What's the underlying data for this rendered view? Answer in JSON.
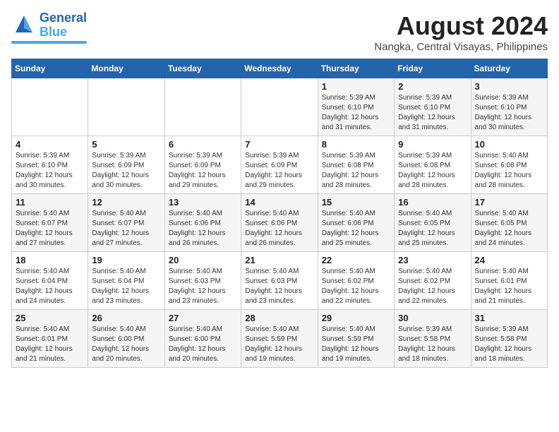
{
  "header": {
    "logo_line1": "General",
    "logo_line2": "Blue",
    "title": "August 2024",
    "subtitle": "Nangka, Central Visayas, Philippines"
  },
  "days_of_week": [
    "Sunday",
    "Monday",
    "Tuesday",
    "Wednesday",
    "Thursday",
    "Friday",
    "Saturday"
  ],
  "weeks": [
    [
      {
        "day": "",
        "info": ""
      },
      {
        "day": "",
        "info": ""
      },
      {
        "day": "",
        "info": ""
      },
      {
        "day": "",
        "info": ""
      },
      {
        "day": "1",
        "info": "Sunrise: 5:39 AM\nSunset: 6:10 PM\nDaylight: 12 hours\nand 31 minutes."
      },
      {
        "day": "2",
        "info": "Sunrise: 5:39 AM\nSunset: 6:10 PM\nDaylight: 12 hours\nand 31 minutes."
      },
      {
        "day": "3",
        "info": "Sunrise: 5:39 AM\nSunset: 6:10 PM\nDaylight: 12 hours\nand 30 minutes."
      }
    ],
    [
      {
        "day": "4",
        "info": "Sunrise: 5:39 AM\nSunset: 6:10 PM\nDaylight: 12 hours\nand 30 minutes."
      },
      {
        "day": "5",
        "info": "Sunrise: 5:39 AM\nSunset: 6:09 PM\nDaylight: 12 hours\nand 30 minutes."
      },
      {
        "day": "6",
        "info": "Sunrise: 5:39 AM\nSunset: 6:09 PM\nDaylight: 12 hours\nand 29 minutes."
      },
      {
        "day": "7",
        "info": "Sunrise: 5:39 AM\nSunset: 6:09 PM\nDaylight: 12 hours\nand 29 minutes."
      },
      {
        "day": "8",
        "info": "Sunrise: 5:39 AM\nSunset: 6:08 PM\nDaylight: 12 hours\nand 28 minutes."
      },
      {
        "day": "9",
        "info": "Sunrise: 5:39 AM\nSunset: 6:08 PM\nDaylight: 12 hours\nand 28 minutes."
      },
      {
        "day": "10",
        "info": "Sunrise: 5:40 AM\nSunset: 6:08 PM\nDaylight: 12 hours\nand 28 minutes."
      }
    ],
    [
      {
        "day": "11",
        "info": "Sunrise: 5:40 AM\nSunset: 6:07 PM\nDaylight: 12 hours\nand 27 minutes."
      },
      {
        "day": "12",
        "info": "Sunrise: 5:40 AM\nSunset: 6:07 PM\nDaylight: 12 hours\nand 27 minutes."
      },
      {
        "day": "13",
        "info": "Sunrise: 5:40 AM\nSunset: 6:06 PM\nDaylight: 12 hours\nand 26 minutes."
      },
      {
        "day": "14",
        "info": "Sunrise: 5:40 AM\nSunset: 6:06 PM\nDaylight: 12 hours\nand 26 minutes."
      },
      {
        "day": "15",
        "info": "Sunrise: 5:40 AM\nSunset: 6:06 PM\nDaylight: 12 hours\nand 25 minutes."
      },
      {
        "day": "16",
        "info": "Sunrise: 5:40 AM\nSunset: 6:05 PM\nDaylight: 12 hours\nand 25 minutes."
      },
      {
        "day": "17",
        "info": "Sunrise: 5:40 AM\nSunset: 6:05 PM\nDaylight: 12 hours\nand 24 minutes."
      }
    ],
    [
      {
        "day": "18",
        "info": "Sunrise: 5:40 AM\nSunset: 6:04 PM\nDaylight: 12 hours\nand 24 minutes."
      },
      {
        "day": "19",
        "info": "Sunrise: 5:40 AM\nSunset: 6:04 PM\nDaylight: 12 hours\nand 23 minutes."
      },
      {
        "day": "20",
        "info": "Sunrise: 5:40 AM\nSunset: 6:03 PM\nDaylight: 12 hours\nand 23 minutes."
      },
      {
        "day": "21",
        "info": "Sunrise: 5:40 AM\nSunset: 6:03 PM\nDaylight: 12 hours\nand 23 minutes."
      },
      {
        "day": "22",
        "info": "Sunrise: 5:40 AM\nSunset: 6:02 PM\nDaylight: 12 hours\nand 22 minutes."
      },
      {
        "day": "23",
        "info": "Sunrise: 5:40 AM\nSunset: 6:02 PM\nDaylight: 12 hours\nand 22 minutes."
      },
      {
        "day": "24",
        "info": "Sunrise: 5:40 AM\nSunset: 6:01 PM\nDaylight: 12 hours\nand 21 minutes."
      }
    ],
    [
      {
        "day": "25",
        "info": "Sunrise: 5:40 AM\nSunset: 6:01 PM\nDaylight: 12 hours\nand 21 minutes."
      },
      {
        "day": "26",
        "info": "Sunrise: 5:40 AM\nSunset: 6:00 PM\nDaylight: 12 hours\nand 20 minutes."
      },
      {
        "day": "27",
        "info": "Sunrise: 5:40 AM\nSunset: 6:00 PM\nDaylight: 12 hours\nand 20 minutes."
      },
      {
        "day": "28",
        "info": "Sunrise: 5:40 AM\nSunset: 5:59 PM\nDaylight: 12 hours\nand 19 minutes."
      },
      {
        "day": "29",
        "info": "Sunrise: 5:40 AM\nSunset: 5:59 PM\nDaylight: 12 hours\nand 19 minutes."
      },
      {
        "day": "30",
        "info": "Sunrise: 5:39 AM\nSunset: 5:58 PM\nDaylight: 12 hours\nand 18 minutes."
      },
      {
        "day": "31",
        "info": "Sunrise: 5:39 AM\nSunset: 5:58 PM\nDaylight: 12 hours\nand 18 minutes."
      }
    ]
  ]
}
